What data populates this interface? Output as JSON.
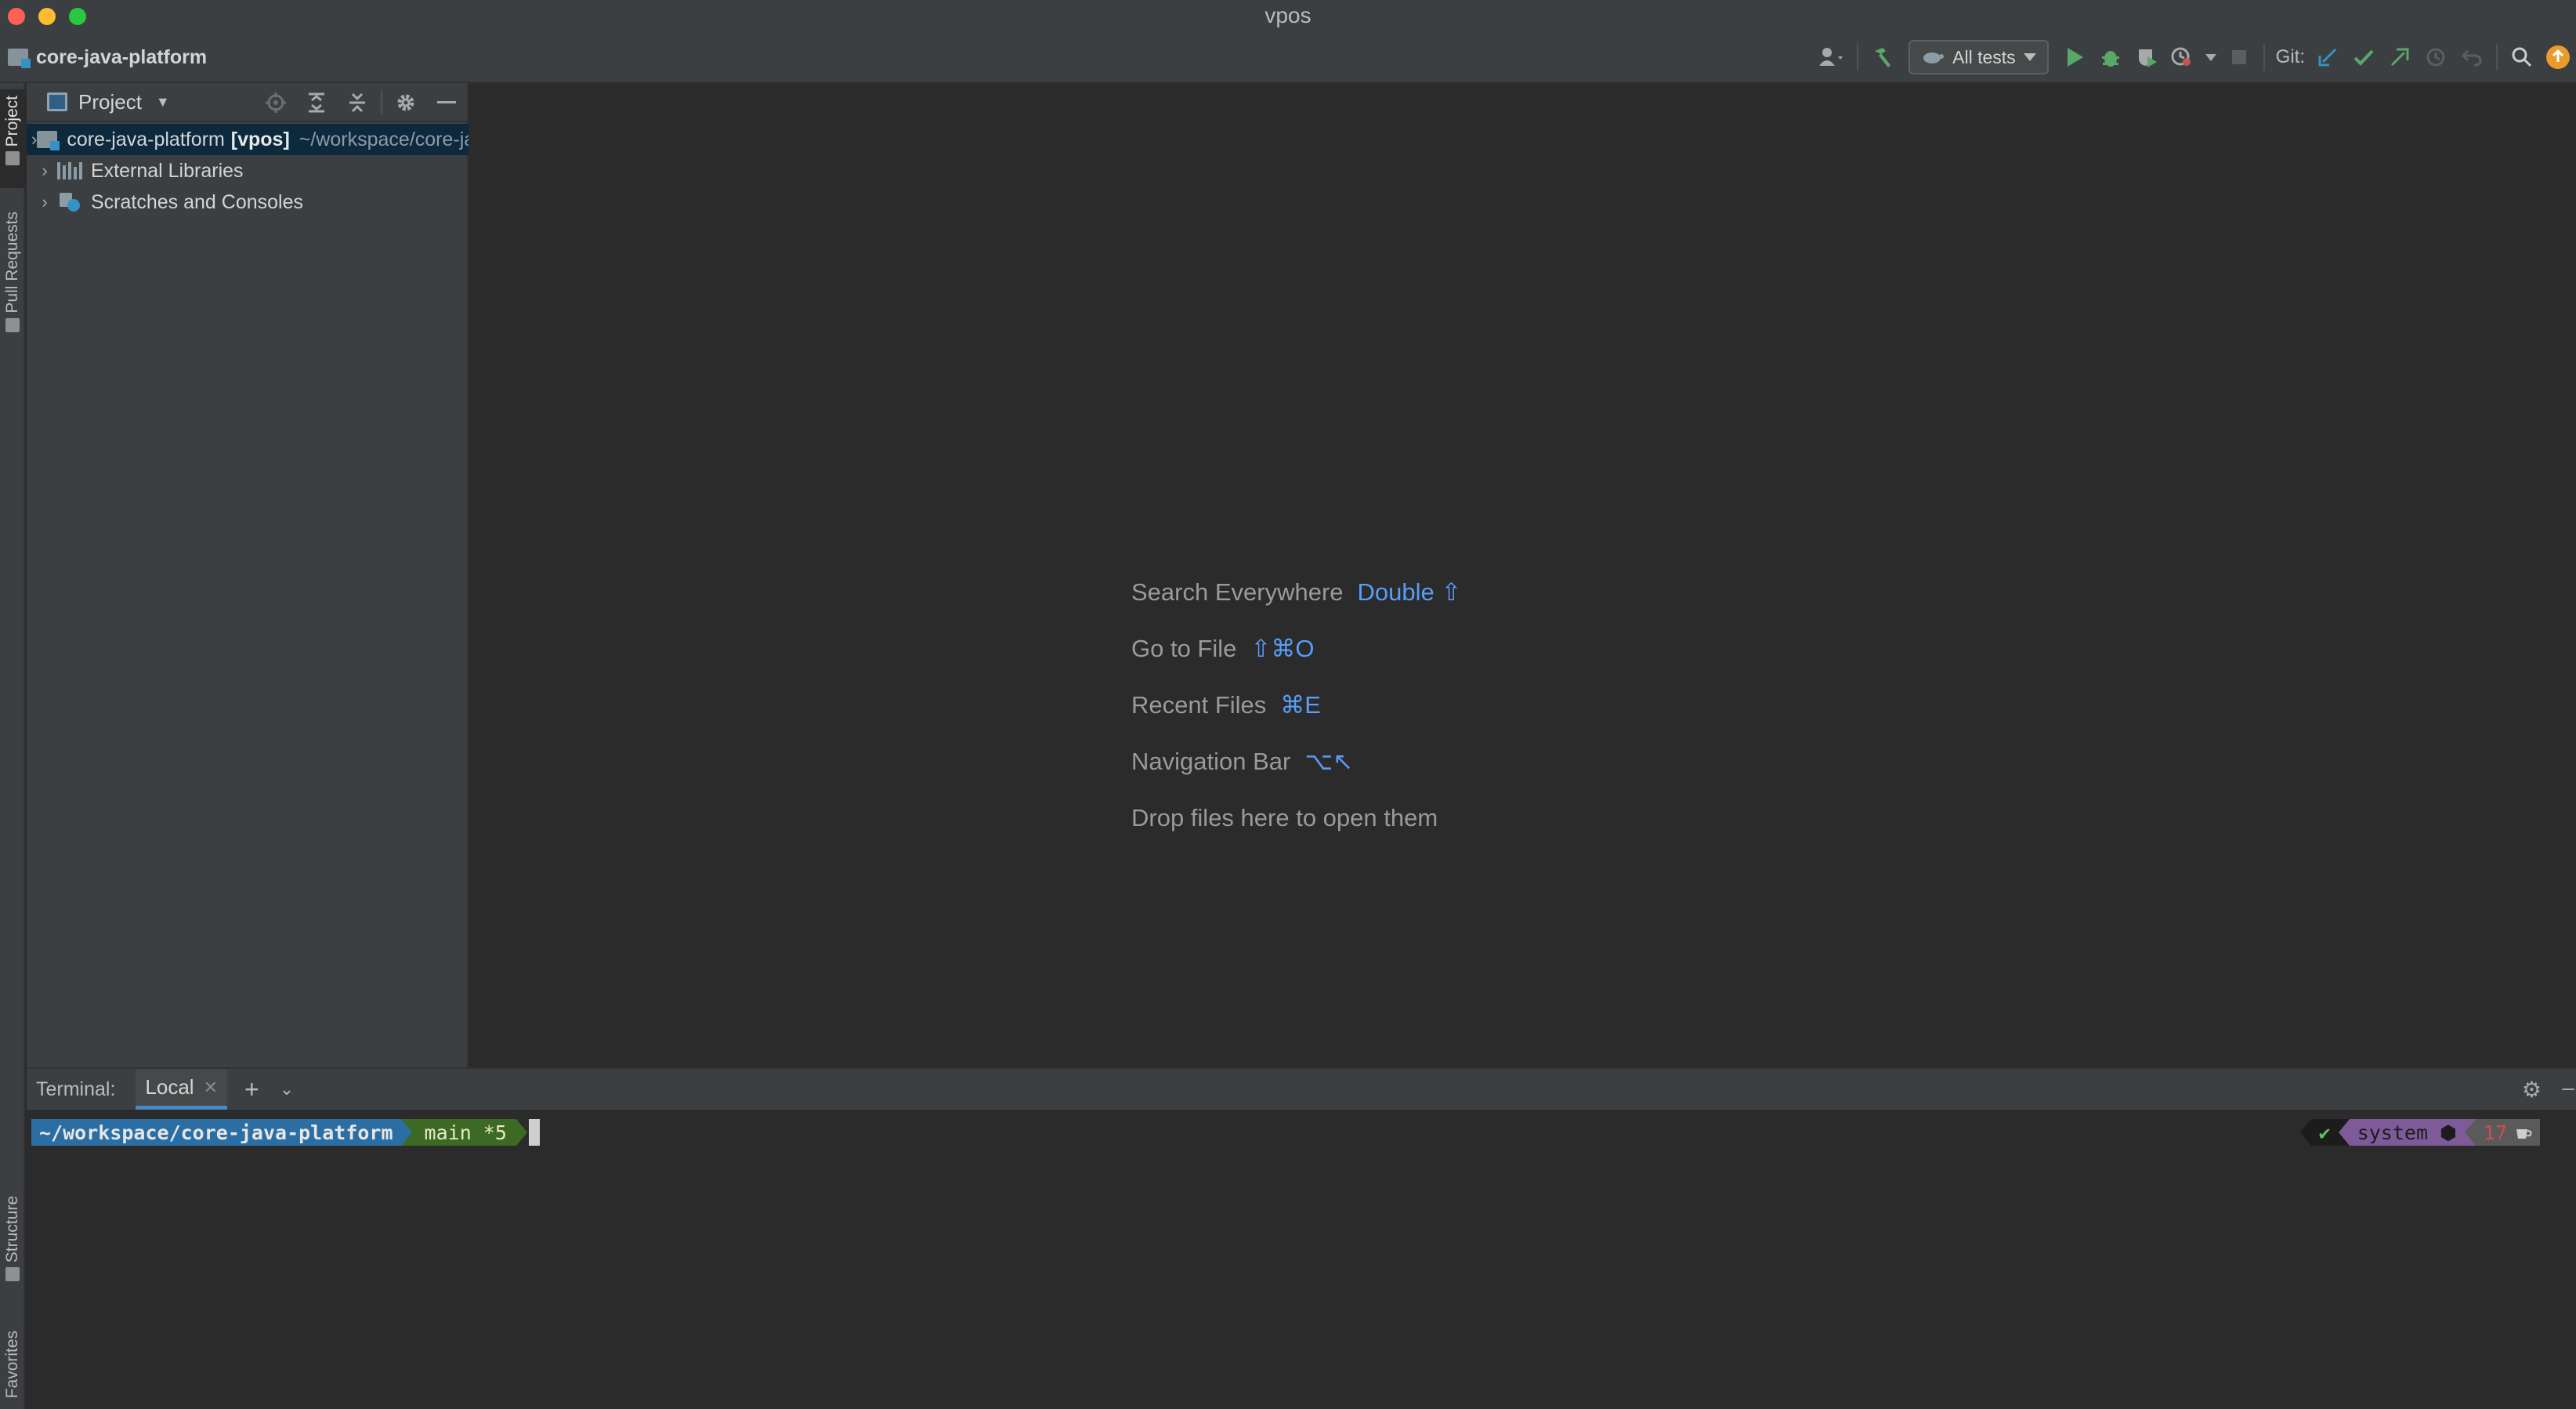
{
  "window": {
    "title": "vpos"
  },
  "navbar": {
    "project_name": "core-java-platform"
  },
  "toolbar": {
    "run_config": "All tests",
    "git_label": "Git:"
  },
  "left_stripe": {
    "project": "Project",
    "pull_requests": "Pull Requests",
    "structure": "Structure",
    "favorites": "Favorites"
  },
  "project_panel": {
    "title": "Project",
    "tree": [
      {
        "label": "core-java-platform",
        "module": "[vpos]",
        "path": "~/workspace/core-java-platform"
      },
      {
        "label": "External Libraries"
      },
      {
        "label": "Scratches and Consoles"
      }
    ]
  },
  "editor_hints": [
    {
      "text": "Search Everywhere",
      "shortcut": "Double ⇧"
    },
    {
      "text": "Go to File",
      "shortcut": "⇧⌘O"
    },
    {
      "text": "Recent Files",
      "shortcut": "⌘E"
    },
    {
      "text": "Navigation Bar",
      "shortcut": "⌥↖"
    },
    {
      "text": "Drop files here to open them",
      "shortcut": ""
    }
  ],
  "terminal": {
    "label": "Terminal:",
    "tab": "Local",
    "prompt_path": "~/workspace/core-java-platform",
    "prompt_git": "main *5",
    "right_ok": "✔",
    "right_env": "system ⬢",
    "right_count": "17"
  },
  "colors": {
    "accent": "#589df6",
    "run_green": "#59a869",
    "git_blue": "#3592c4"
  }
}
